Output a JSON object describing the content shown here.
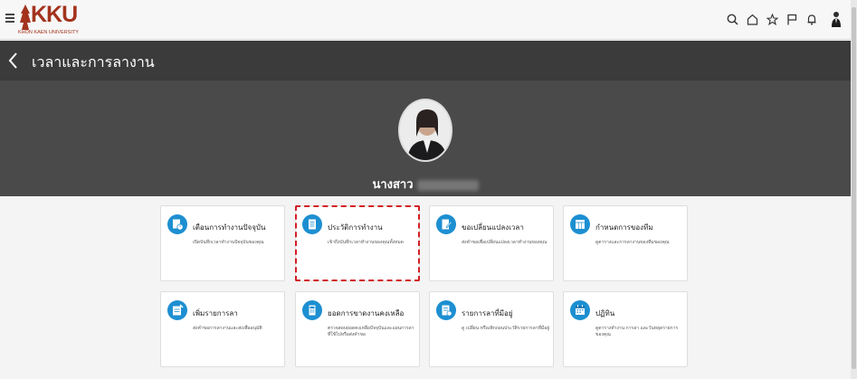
{
  "header": {
    "logo_text": "KKU",
    "logo_subtitle": "KHON KAEN UNIVERSITY",
    "icons": [
      "search-icon",
      "home-icon",
      "star-icon",
      "flag-icon",
      "bell-icon",
      "user-avatar"
    ]
  },
  "titlebar": {
    "title": "เวลาและการลางาน"
  },
  "profile": {
    "name_prefix": "นางสาว"
  },
  "tiles": [
    {
      "title": "เตือนการทำงานปัจจุบัน",
      "desc": "เปิดบันทึกเวลาทำงานปัจจุบันของคุณ",
      "icon": "clock-doc-icon"
    },
    {
      "title": "ประวัติการทำงาน",
      "desc": "เข้าถึงบันทึกเวลาทำงานของคุณทั้งหมด",
      "icon": "document-icon"
    },
    {
      "title": "ขอเปลี่ยนแปลงเวลา",
      "desc": "ส่งคำขอเพื่อเปลี่ยนแปลงเวลาทำงานของคุณ",
      "icon": "edit-doc-icon"
    },
    {
      "title": "กำหนดการของทีม",
      "desc": "ดูตารางและการลางานของทีมของคุณ",
      "icon": "team-schedule-icon"
    },
    {
      "title": "เพิ่มรายการลา",
      "desc": "ส่งคำขอการลางานและส่งเพื่ออนุมัติ",
      "icon": "add-leave-icon"
    },
    {
      "title": "ยอดการขาดงานคงเหลือ",
      "desc": "ตรวจสอบยอดคงเหลือปัจจุบันและแผนการลาที่ใช้ไปหรือส่งคำขอ",
      "icon": "calculator-icon"
    },
    {
      "title": "รายการลาที่มีอยู่",
      "desc": "ดู เปลี่ยน หรือเพิกถอนประวัติรายการลาที่มีอยู่",
      "icon": "leave-list-icon"
    },
    {
      "title": "ปฏิทิน",
      "desc": "ดูตารางทำงาน การลา และวันหยุดรายการของคุณ",
      "icon": "calendar-icon"
    }
  ],
  "colors": {
    "accent": "#1d8fd1",
    "highlight": "#d21f26",
    "titlebar": "#3b3b3b",
    "hero": "#4a4a4a",
    "brand": "#a3331d"
  }
}
